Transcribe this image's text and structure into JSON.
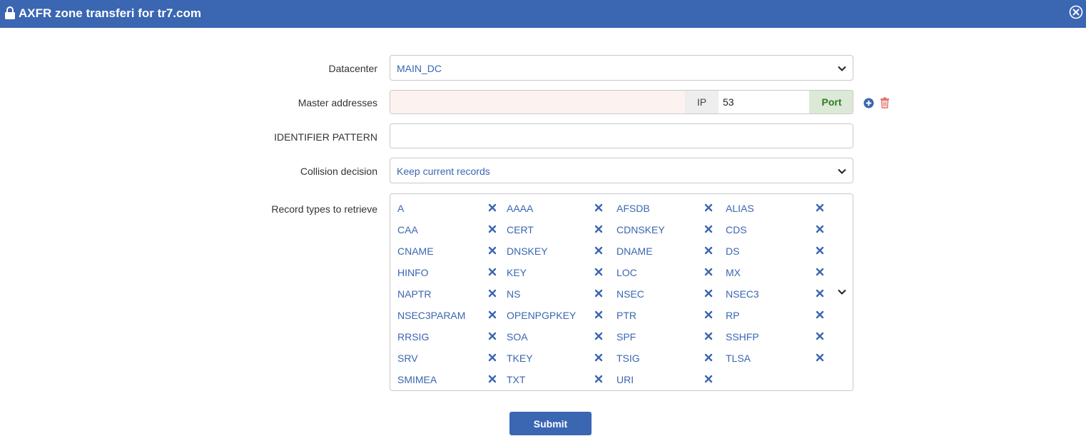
{
  "dialog": {
    "title": "AXFR zone transferi for tr7.com",
    "icon": "lock-icon",
    "close_icon": "close-circle-icon"
  },
  "form": {
    "datacenter": {
      "label": "Datacenter",
      "value": "MAIN_DC"
    },
    "master_addresses": {
      "label": "Master addresses",
      "ip_value": "",
      "ip_addon": "IP",
      "port_value": "53",
      "port_addon": "Port"
    },
    "identifier_pattern": {
      "label": "IDENTIFIER PATTERN",
      "value": ""
    },
    "collision_decision": {
      "label": "Collision decision",
      "value": "Keep current records"
    },
    "record_types": {
      "label": "Record types to retrieve",
      "selected": [
        "A",
        "AAAA",
        "AFSDB",
        "ALIAS",
        "CAA",
        "CERT",
        "CDNSKEY",
        "CDS",
        "CNAME",
        "DNSKEY",
        "DNAME",
        "DS",
        "HINFO",
        "KEY",
        "LOC",
        "MX",
        "NAPTR",
        "NS",
        "NSEC",
        "NSEC3",
        "NSEC3PARAM",
        "OPENPGPKEY",
        "PTR",
        "RP",
        "RRSIG",
        "SOA",
        "SPF",
        "SSHFP",
        "SRV",
        "TKEY",
        "TSIG",
        "TLSA",
        "SMIMEA",
        "TXT",
        "URI"
      ]
    },
    "submit_label": "Submit"
  },
  "colors": {
    "accent": "#3a66b2",
    "delete": "#e0706a",
    "port": "#2f7d25"
  }
}
